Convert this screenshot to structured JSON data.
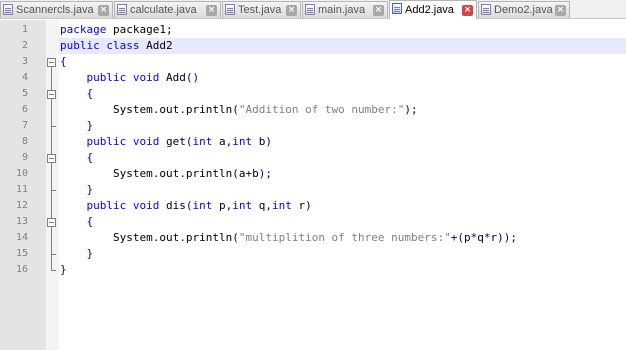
{
  "tabs": [
    {
      "label": "Scannercls.java",
      "active": false
    },
    {
      "label": "calculate.java",
      "active": false
    },
    {
      "label": "Test.java",
      "active": false
    },
    {
      "label": "main.java",
      "active": false
    },
    {
      "label": "Add2.java",
      "active": true
    },
    {
      "label": "Demo2.java",
      "active": false
    }
  ],
  "tab_close_glyph": "×",
  "editor": {
    "current_line": 2,
    "lines": [
      {
        "num": "1",
        "indent": "",
        "tokens": [
          {
            "t": "kw",
            "v": "package"
          },
          {
            "t": "id",
            "v": " package1;"
          }
        ]
      },
      {
        "num": "2",
        "indent": "",
        "tokens": [
          {
            "t": "kw",
            "v": "public"
          },
          {
            "t": "id",
            "v": " "
          },
          {
            "t": "kw",
            "v": "class"
          },
          {
            "t": "id",
            "v": " Add2"
          }
        ]
      },
      {
        "num": "3",
        "indent": "",
        "tokens": [
          {
            "t": "op",
            "v": "{"
          }
        ]
      },
      {
        "num": "4",
        "indent": "    ",
        "tokens": [
          {
            "t": "kw",
            "v": "public"
          },
          {
            "t": "id",
            "v": " "
          },
          {
            "t": "kw",
            "v": "void"
          },
          {
            "t": "id",
            "v": " Add"
          },
          {
            "t": "op",
            "v": "()"
          }
        ]
      },
      {
        "num": "5",
        "indent": "    ",
        "tokens": [
          {
            "t": "op",
            "v": "{"
          }
        ]
      },
      {
        "num": "6",
        "indent": "        ",
        "tokens": [
          {
            "t": "id",
            "v": "System"
          },
          {
            "t": "op",
            "v": "."
          },
          {
            "t": "id",
            "v": "out"
          },
          {
            "t": "op",
            "v": "."
          },
          {
            "t": "id",
            "v": "println"
          },
          {
            "t": "op",
            "v": "("
          },
          {
            "t": "str",
            "v": "\"Addition of two number:\""
          },
          {
            "t": "op",
            "v": ");"
          }
        ]
      },
      {
        "num": "7",
        "indent": "    ",
        "tokens": [
          {
            "t": "op",
            "v": "}"
          }
        ]
      },
      {
        "num": "8",
        "indent": "    ",
        "tokens": [
          {
            "t": "kw",
            "v": "public"
          },
          {
            "t": "id",
            "v": " "
          },
          {
            "t": "kw",
            "v": "void"
          },
          {
            "t": "id",
            "v": " get"
          },
          {
            "t": "op",
            "v": "("
          },
          {
            "t": "kw",
            "v": "int"
          },
          {
            "t": "id",
            "v": " a"
          },
          {
            "t": "op",
            "v": ","
          },
          {
            "t": "kw",
            "v": "int"
          },
          {
            "t": "id",
            "v": " b"
          },
          {
            "t": "op",
            "v": ")"
          }
        ]
      },
      {
        "num": "9",
        "indent": "    ",
        "tokens": [
          {
            "t": "op",
            "v": "{"
          }
        ]
      },
      {
        "num": "10",
        "indent": "        ",
        "tokens": [
          {
            "t": "id",
            "v": "System"
          },
          {
            "t": "op",
            "v": "."
          },
          {
            "t": "id",
            "v": "out"
          },
          {
            "t": "op",
            "v": "."
          },
          {
            "t": "id",
            "v": "println"
          },
          {
            "t": "op",
            "v": "("
          },
          {
            "t": "id",
            "v": "a"
          },
          {
            "t": "op",
            "v": "+"
          },
          {
            "t": "id",
            "v": "b"
          },
          {
            "t": "op",
            "v": ");"
          }
        ]
      },
      {
        "num": "11",
        "indent": "    ",
        "tokens": [
          {
            "t": "op",
            "v": "}"
          }
        ]
      },
      {
        "num": "12",
        "indent": "    ",
        "tokens": [
          {
            "t": "kw",
            "v": "public"
          },
          {
            "t": "id",
            "v": " "
          },
          {
            "t": "kw",
            "v": "void"
          },
          {
            "t": "id",
            "v": " dis"
          },
          {
            "t": "op",
            "v": "("
          },
          {
            "t": "kw",
            "v": "int"
          },
          {
            "t": "id",
            "v": " p"
          },
          {
            "t": "op",
            "v": ","
          },
          {
            "t": "kw",
            "v": "int"
          },
          {
            "t": "id",
            "v": " q"
          },
          {
            "t": "op",
            "v": ","
          },
          {
            "t": "kw",
            "v": "int"
          },
          {
            "t": "id",
            "v": " r"
          },
          {
            "t": "op",
            "v": ")"
          }
        ]
      },
      {
        "num": "13",
        "indent": "    ",
        "tokens": [
          {
            "t": "op",
            "v": "{"
          }
        ]
      },
      {
        "num": "14",
        "indent": "        ",
        "tokens": [
          {
            "t": "id",
            "v": "System"
          },
          {
            "t": "op",
            "v": "."
          },
          {
            "t": "id",
            "v": "out"
          },
          {
            "t": "op",
            "v": "."
          },
          {
            "t": "id",
            "v": "println"
          },
          {
            "t": "op",
            "v": "("
          },
          {
            "t": "str",
            "v": "\"multiplition of three numbers:\""
          },
          {
            "t": "op",
            "v": "+("
          },
          {
            "t": "id",
            "v": "p"
          },
          {
            "t": "op",
            "v": "*"
          },
          {
            "t": "id",
            "v": "q"
          },
          {
            "t": "op",
            "v": "*"
          },
          {
            "t": "id",
            "v": "r"
          },
          {
            "t": "op",
            "v": "));"
          }
        ]
      },
      {
        "num": "15",
        "indent": "    ",
        "tokens": [
          {
            "t": "op",
            "v": "}"
          }
        ]
      },
      {
        "num": "16",
        "indent": "",
        "tokens": [
          {
            "t": "op",
            "v": "}"
          }
        ]
      }
    ]
  },
  "colors": {
    "keyword": "#0000ff",
    "string": "#808080",
    "operator": "#000080",
    "current_line_bg": "#e8e8ff",
    "active_tab_close": "#d64545"
  },
  "icons": {
    "tab_file": "file-icon",
    "tab_close": "close-icon",
    "fold_open": "fold-minus-icon"
  }
}
